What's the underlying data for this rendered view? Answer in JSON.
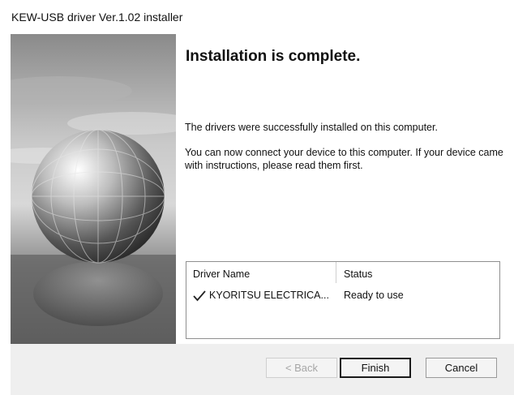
{
  "window": {
    "title": "KEW-USB driver Ver.1.02 installer"
  },
  "content": {
    "heading": "Installation is complete.",
    "message1": "The drivers were successfully installed on this computer.",
    "message2": "You can now connect your device to this computer. If your device came with instructions, please read them first."
  },
  "driver_list": {
    "columns": [
      "Driver Name",
      "Status"
    ],
    "rows": [
      {
        "icon": "checkmark-icon",
        "name": "KYORITSU ELECTRICA...",
        "status": "Ready to use"
      }
    ]
  },
  "buttons": {
    "back": "< Back",
    "finish": "Finish",
    "cancel": "Cancel"
  },
  "banner": {
    "icon": "globe-graphic"
  }
}
